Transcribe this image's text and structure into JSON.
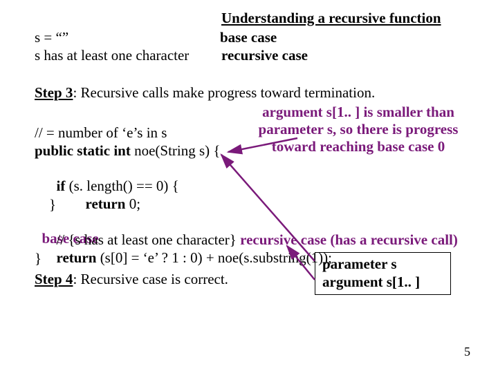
{
  "title": "Understanding a recursive function",
  "cases": {
    "line1_left": "s = “”",
    "line1_right": "base case",
    "line2_left": "s has at least one character",
    "line2_right": "recursive case"
  },
  "step3": {
    "label": "Step 3",
    "text": ": Recursive calls make progress toward termination."
  },
  "progress_note": {
    "l1": "argument s[1.. ] is smaller than",
    "l2": "parameter s, so there is progress",
    "l3": "toward reaching base case 0"
  },
  "code": {
    "c1": "// = number of ‘e’s in s",
    "c2a": "public static int",
    "c2b": " noe(String  s) {",
    "c3a": "    if",
    "c3b": " (s. length() == 0) {",
    "c4a": "            return",
    "c4b": " 0;",
    "c4note": "base case",
    "c5": "    }",
    "c6a": "    // {s has at least one character} ",
    "c6b": "recursive case (has a recursive call)",
    "c7a": "    return",
    "c7b": " (s[0] = ‘e’ ? 1 : 0) + noe(s.substring(1));",
    "c8": "}"
  },
  "step4": {
    "label": "Step 4",
    "text": ": Recursive case is correct."
  },
  "box_labels": {
    "top": "parameter s",
    "bottom": "argument s[1.. ]"
  },
  "page": "5"
}
